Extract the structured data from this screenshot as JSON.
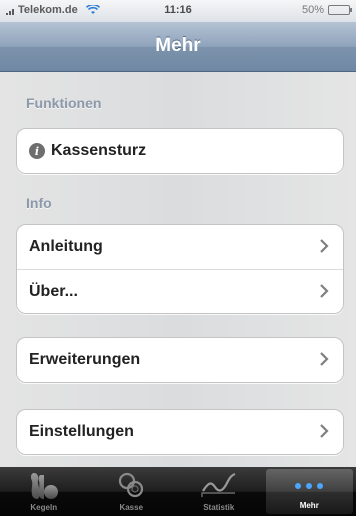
{
  "status_bar": {
    "carrier": "Telekom.de",
    "time": "11:16",
    "battery": "50%"
  },
  "nav": {
    "title": "Mehr"
  },
  "sections": {
    "funktionen": "Funktionen",
    "info": "Info"
  },
  "cells": {
    "kassensturz": "Kassensturz",
    "anleitung": "Anleitung",
    "ueber": "Über...",
    "erweiterungen": "Erweiterungen",
    "einstellungen": "Einstellungen"
  },
  "tabs": [
    {
      "label": "Kegeln",
      "icon": "kegel-icon"
    },
    {
      "label": "Kasse",
      "icon": "coins-icon"
    },
    {
      "label": "Statistik",
      "icon": "chart-icon"
    },
    {
      "label": "Mehr",
      "icon": "more-icon",
      "active": true
    }
  ],
  "colors": {
    "nav_bar": "#7d93ad",
    "section_header": "#8d99aa",
    "tab_bar": "#1e1e1e"
  }
}
